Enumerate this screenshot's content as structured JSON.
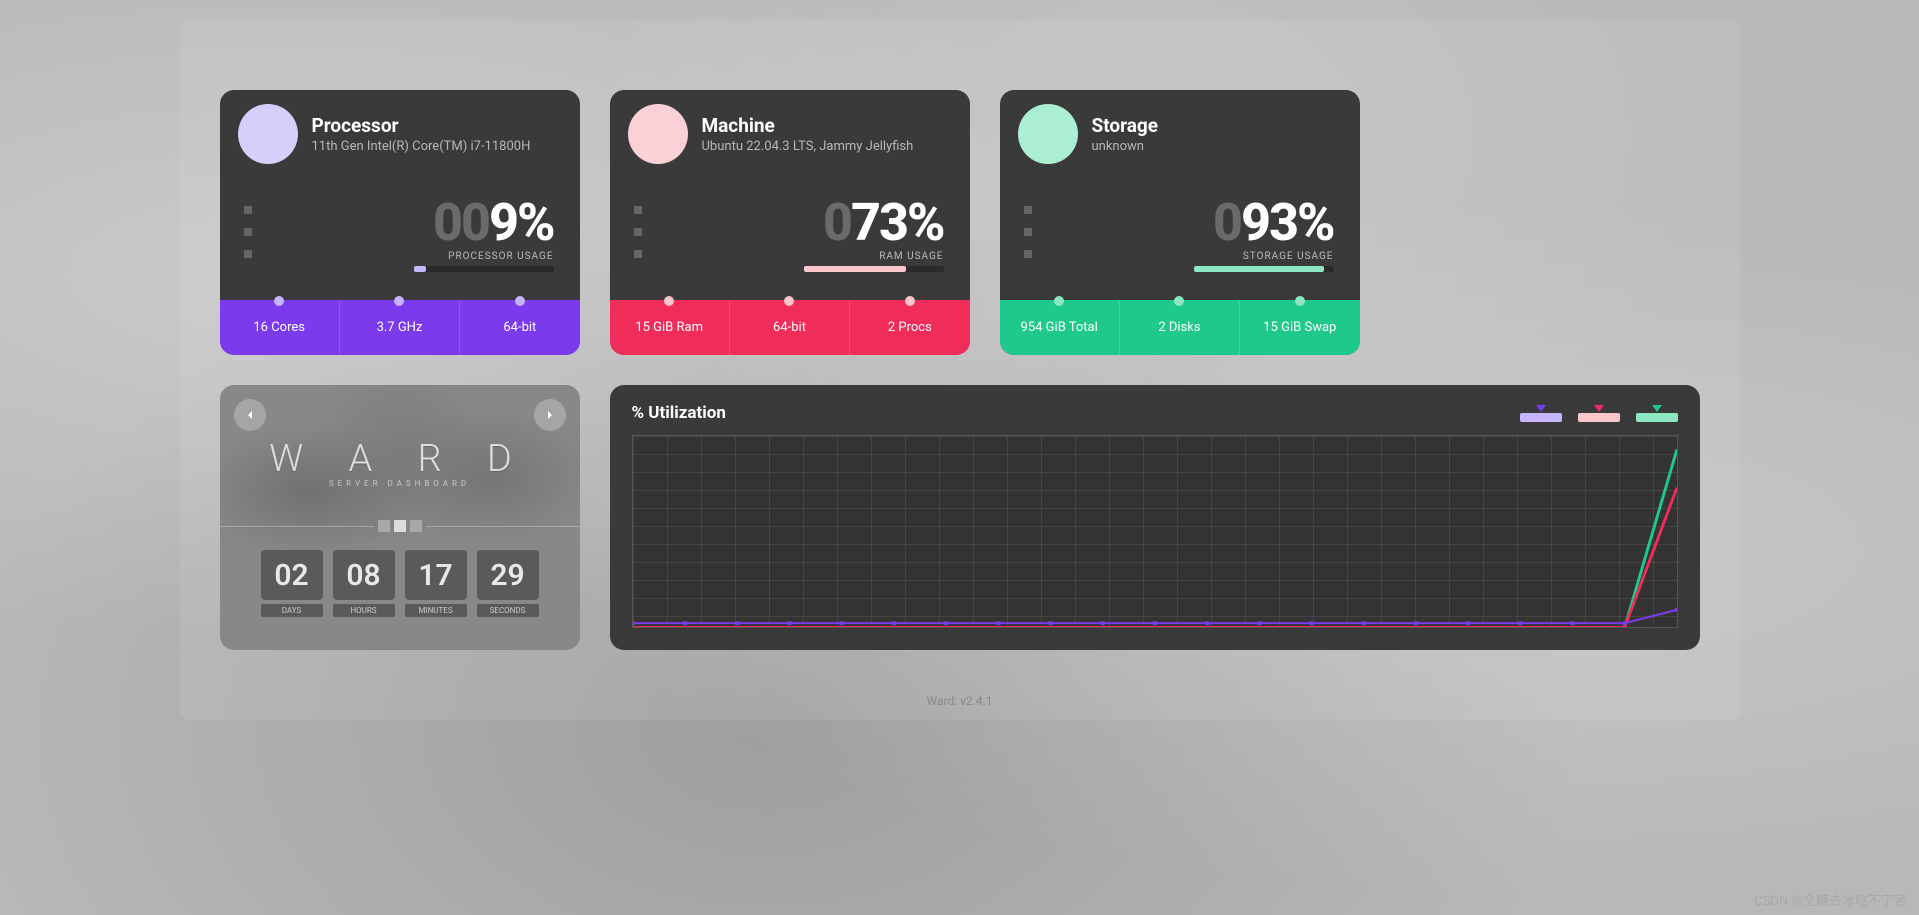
{
  "cards": {
    "processor": {
      "title": "Processor",
      "subtitle": "11th Gen Intel(R) Core(TM) i7-11800H",
      "usage_dim": "00",
      "usage_val": "9",
      "usage_pct": 9,
      "usage_label": "PROCESSOR USAGE",
      "stats": [
        "16 Cores",
        "3.7 GHz",
        "64-bit"
      ],
      "accent": "#7c3aed",
      "bar_color": "#c4b5fd"
    },
    "machine": {
      "title": "Machine",
      "subtitle": "Ubuntu 22.04.3 LTS, Jammy Jellyfish",
      "usage_dim": "0",
      "usage_val": "73",
      "usage_pct": 73,
      "usage_label": "RAM USAGE",
      "stats": [
        "15 GiB Ram",
        "64-bit",
        "2 Procs"
      ],
      "accent": "#ef2c5a",
      "bar_color": "#fbc5cc"
    },
    "storage": {
      "title": "Storage",
      "subtitle": "unknown",
      "usage_dim": "0",
      "usage_val": "93",
      "usage_pct": 93,
      "usage_label": "STORAGE USAGE",
      "stats": [
        "954 GiB Total",
        "2 Disks",
        "15 GiB Swap"
      ],
      "accent": "#1ec98b",
      "bar_color": "#8de8c2"
    }
  },
  "ward": {
    "title": "W A R D",
    "subtitle": "SERVER DASHBOARD",
    "uptime": {
      "days": "02",
      "hours": "08",
      "minutes": "17",
      "seconds": "29"
    },
    "labels": {
      "days": "DAYS",
      "hours": "HOURS",
      "minutes": "MINUTES",
      "seconds": "SECONDS"
    }
  },
  "chart": {
    "title": "% Utilization",
    "legend_colors": {
      "purple": "#c4b5fd",
      "pink": "#fbc5cc",
      "green": "#8de8c2",
      "tri_purple": "#7c3aed",
      "tri_pink": "#ef2c5a",
      "tri_green": "#1ec98b"
    }
  },
  "chart_data": {
    "type": "line",
    "title": "% Utilization",
    "xlabel": "",
    "ylabel": "",
    "ylim": [
      0,
      100
    ],
    "x": [
      0,
      1,
      2,
      3,
      4,
      5,
      6,
      7,
      8,
      9,
      10,
      11,
      12,
      13,
      14,
      15,
      16,
      17,
      18,
      19,
      20
    ],
    "series": [
      {
        "name": "Processor",
        "color": "#7c3aed",
        "values": [
          2,
          2,
          2,
          2,
          2,
          2,
          2,
          2,
          2,
          2,
          2,
          2,
          2,
          2,
          2,
          2,
          2,
          2,
          2,
          2,
          9
        ]
      },
      {
        "name": "Machine",
        "color": "#ef2c5a",
        "values": [
          0,
          0,
          0,
          0,
          0,
          0,
          0,
          0,
          0,
          0,
          0,
          0,
          0,
          0,
          0,
          0,
          0,
          0,
          0,
          0,
          73
        ]
      },
      {
        "name": "Storage",
        "color": "#1ec98b",
        "values": [
          0,
          0,
          0,
          0,
          0,
          0,
          0,
          0,
          0,
          0,
          0,
          0,
          0,
          0,
          0,
          0,
          0,
          0,
          0,
          0,
          93
        ]
      }
    ]
  },
  "version": "Ward: v2.4.1",
  "watermark": "CSDN @全糖去冰吃不了苦"
}
